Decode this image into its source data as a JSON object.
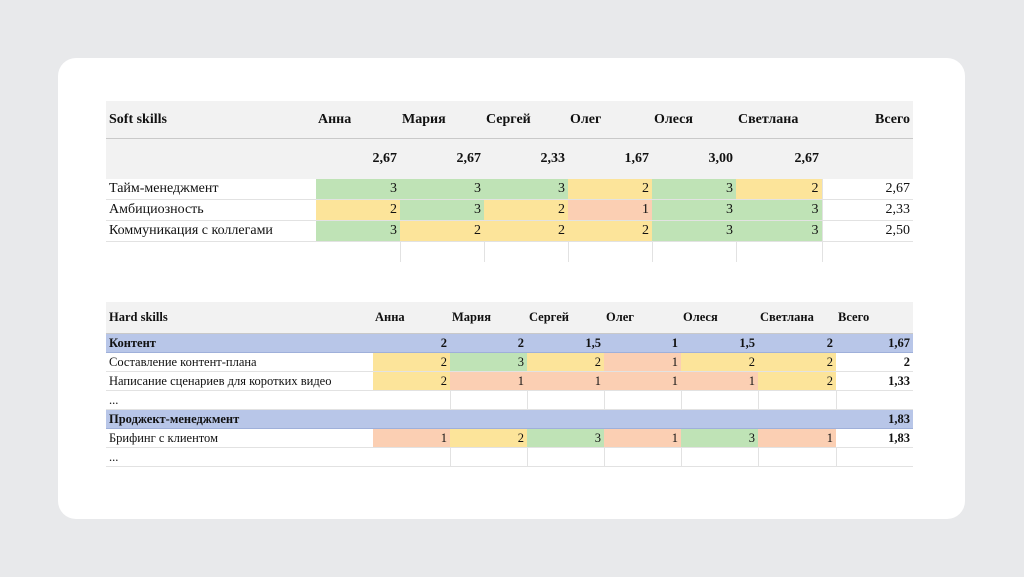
{
  "soft": {
    "title": "Soft skills",
    "headers": [
      "Анна",
      "Мария",
      "Сергей",
      "Олег",
      "Олеся",
      "Светлана"
    ],
    "total_label": "Всего",
    "averages": [
      "2,67",
      "2,67",
      "2,33",
      "1,67",
      "3,00",
      "2,67"
    ],
    "rows": [
      {
        "name": "Тайм-менеджмент",
        "values": [
          "3",
          "3",
          "3",
          "2",
          "3",
          "2"
        ],
        "total": "2,67"
      },
      {
        "name": "Амбициозность",
        "values": [
          "2",
          "3",
          "2",
          "1",
          "3",
          "3"
        ],
        "total": "2,33"
      },
      {
        "name": "Коммуникация с коллегами",
        "values": [
          "3",
          "2",
          "2",
          "2",
          "3",
          "3"
        ],
        "total": "2,50"
      }
    ]
  },
  "hard": {
    "title": "Hard skills",
    "headers": [
      "Анна",
      "Мария",
      "Сергей",
      "Олег",
      "Олеся",
      "Светлана"
    ],
    "total_label": "Всего",
    "sections": [
      {
        "name": "Контент",
        "values": [
          "2",
          "2",
          "1,5",
          "1",
          "1,5",
          "2"
        ],
        "total": "1,67",
        "rows": [
          {
            "name": "Составление контент-плана",
            "values": [
              "2",
              "3",
              "2",
              "1",
              "2",
              "2"
            ],
            "total": "2"
          },
          {
            "name": "Написание сценариев для коротких видео",
            "values": [
              "2",
              "1",
              "1",
              "1",
              "1",
              "2"
            ],
            "total": "1,33"
          }
        ],
        "ellipsis": "..."
      },
      {
        "name": "Проджект-менеджмент",
        "values": [
          "",
          "",
          "",
          "",
          "",
          ""
        ],
        "total": "1,83",
        "rows": [
          {
            "name": "Брифинг с клиентом",
            "values": [
              "1",
              "2",
              "3",
              "1",
              "3",
              "1"
            ],
            "total": "1,83"
          }
        ],
        "ellipsis": "..."
      }
    ]
  }
}
